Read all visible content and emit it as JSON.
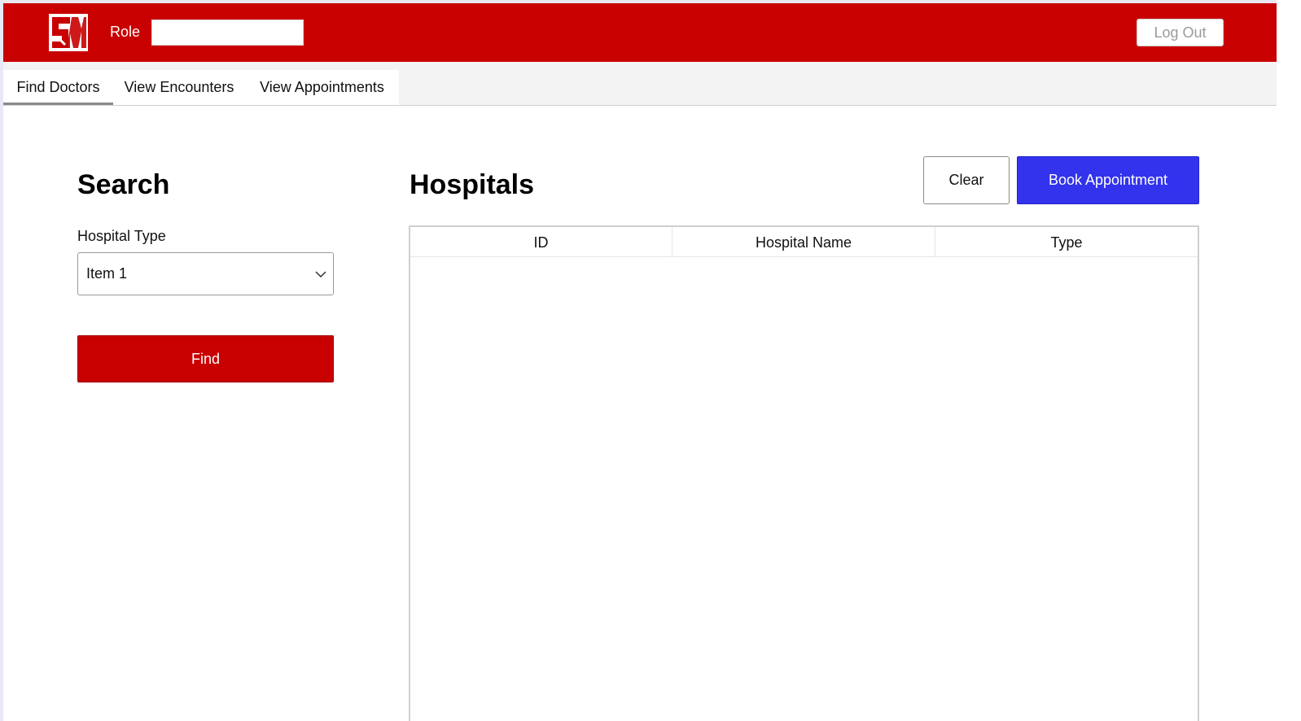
{
  "header": {
    "logo_icon": "sm-logo",
    "role_label": "Role",
    "role_value": "",
    "logout_label": "Log Out",
    "brand_color": "#c80000"
  },
  "tabs": [
    {
      "label": "Find Doctors",
      "active": true
    },
    {
      "label": "View Encounters",
      "active": false
    },
    {
      "label": "View Appointments",
      "active": false
    }
  ],
  "search": {
    "title": "Search",
    "hospital_type_label": "Hospital Type",
    "hospital_type_selected": "Item 1",
    "dropdown_icon": "chevron-down-icon",
    "find_label": "Find"
  },
  "hospitals": {
    "title": "Hospitals",
    "clear_label": "Clear",
    "book_label": "Book Appointment",
    "book_color": "#3333ee",
    "columns": [
      "ID",
      "Hospital Name",
      "Type"
    ],
    "rows": []
  }
}
